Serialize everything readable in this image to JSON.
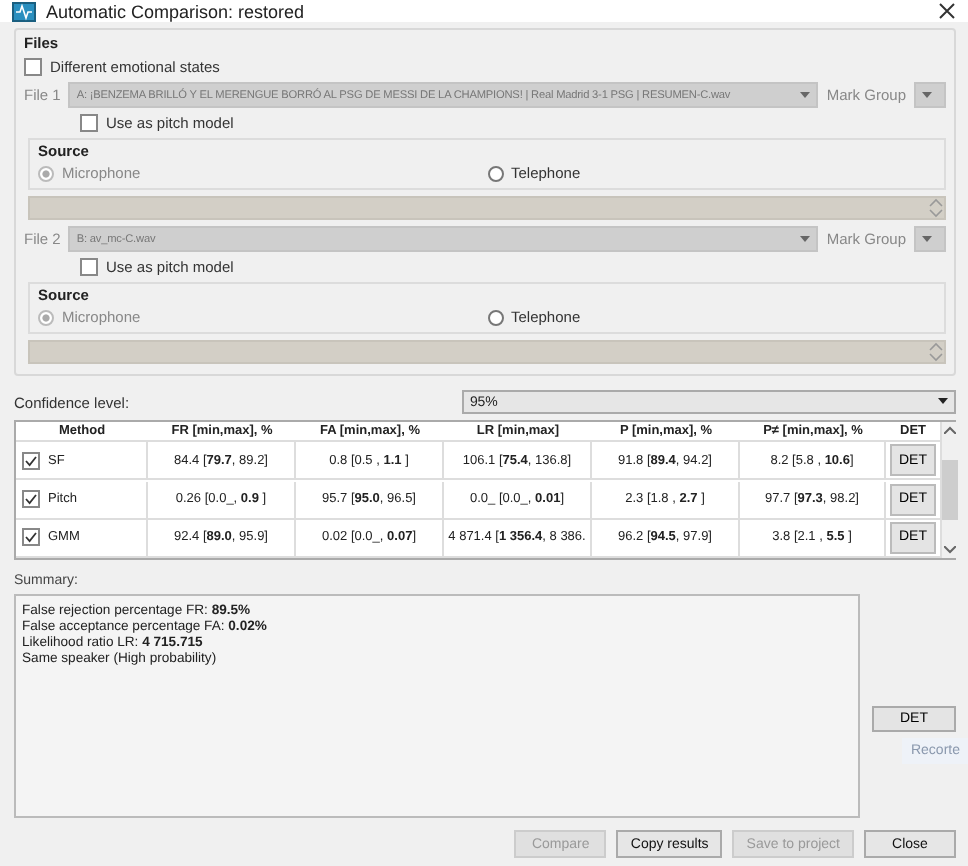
{
  "window": {
    "title": "Automatic Comparison: restored"
  },
  "files": {
    "title": "Files",
    "different_emotional_states": {
      "label": "Different emotional states",
      "checked": false
    },
    "file_entries": [
      {
        "label": "File 1",
        "value": "A: ¡BENZEMA BRILLÓ Y EL MERENGUE BORRÓ AL PSG DE MESSI DE LA CHAMPIONS!  |  Real Madrid 3-1 PSG  |  RESUMEN-C.wav",
        "mark_group_label": "Mark Group",
        "pitch_model": {
          "label": "Use as pitch model",
          "checked": false
        },
        "source": {
          "title": "Source",
          "options": [
            {
              "label": "Microphone",
              "selected": true
            },
            {
              "label": "Telephone",
              "selected": false
            }
          ]
        }
      },
      {
        "label": "File 2",
        "value": "B: av_mc-C.wav",
        "mark_group_label": "Mark Group",
        "pitch_model": {
          "label": "Use as pitch model",
          "checked": false
        },
        "source": {
          "title": "Source",
          "options": [
            {
              "label": "Microphone",
              "selected": true
            },
            {
              "label": "Telephone",
              "selected": false
            }
          ]
        }
      }
    ]
  },
  "confidence": {
    "label": "Confidence level:",
    "value": "95%"
  },
  "table": {
    "columns": [
      "Method",
      "FR [min,max], %",
      "FA [min,max], %",
      "LR [min,max]",
      "P [min,max], %",
      "P≠ [min,max], %",
      "DET"
    ],
    "rows": [
      {
        "checked": true,
        "cells": [
          "SF",
          "84.4 [**79.7**, 89.2]",
          "0.8 [0.5 , **1.1** ]",
          "106.1 [**75.4**, 136.8]",
          "91.8 [**89.4**, 94.2]",
          "8.2 [5.8 , **10.6**]"
        ],
        "button": "DET"
      },
      {
        "checked": true,
        "cells": [
          "Pitch",
          "0.26 [0.0_, **0.9** ]",
          "95.7 [**95.0**, 96.5]",
          "0.0_ [0.0_, **0.01**]",
          "2.3 [1.8 , **2.7** ]",
          "97.7 [**97.3**, 98.2]"
        ],
        "button": "DET"
      },
      {
        "checked": true,
        "cells": [
          "GMM",
          "92.4 [**89.0**, 95.9]",
          "0.02 [0.0_, **0.07**]",
          "4 871.4 [**1 356.4**, 8 386.",
          "96.2 [**94.5**, 97.9]",
          "3.8 [2.1 , **5.5** ]"
        ],
        "button": "DET"
      }
    ]
  },
  "summary": {
    "label": "Summary:",
    "lines": [
      "False rejection percentage FR: **89.5%**",
      "False acceptance percentage FA: **0.02%**",
      "Likelihood ratio LR: **4 715.715**",
      "Same speaker (High probability)"
    ]
  },
  "side_button": "DET",
  "faded_label": "Recorte",
  "buttons": [
    {
      "label": "Compare",
      "disabled": true
    },
    {
      "label": "Copy results",
      "disabled": false
    },
    {
      "label": "Save to project",
      "disabled": true
    },
    {
      "label": "Close",
      "disabled": false
    }
  ]
}
